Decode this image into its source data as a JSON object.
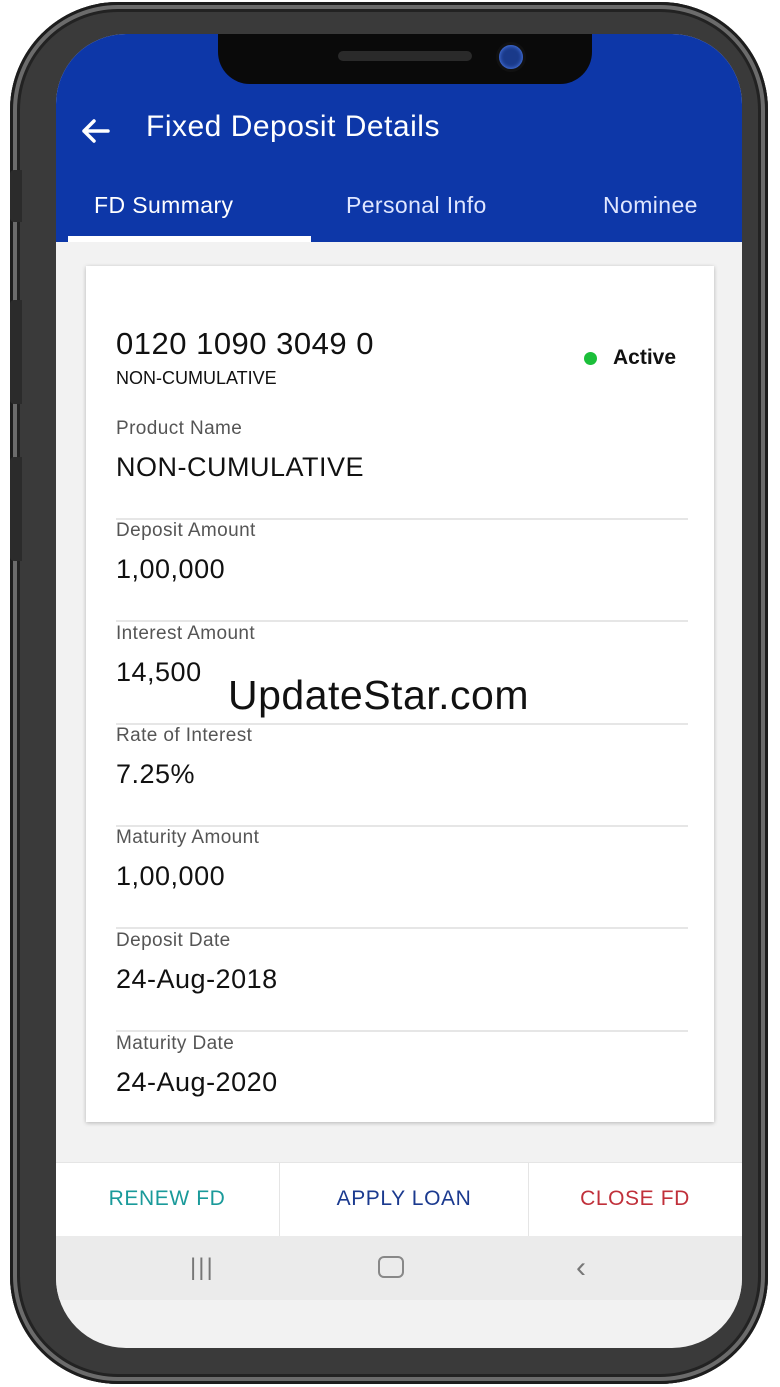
{
  "app": {
    "title": "Fixed Deposit Details",
    "back_icon": "arrow-left-icon"
  },
  "tabs": [
    {
      "label": "FD Summary",
      "active": true
    },
    {
      "label": "Personal Info",
      "active": false
    },
    {
      "label": "Nominee",
      "active": false
    }
  ],
  "account": {
    "number": "0120 1090 3049 0",
    "type": "NON-CUMULATIVE",
    "status": "Active",
    "status_color": "#1bbf3a"
  },
  "fields": [
    {
      "label": "Product Name",
      "value": "NON-CUMULATIVE"
    },
    {
      "label": "Deposit Amount",
      "value": "1,00,000"
    },
    {
      "label": "Interest Amount",
      "value": "14,500"
    },
    {
      "label": "Rate of Interest",
      "value": "7.25%"
    },
    {
      "label": "Maturity Amount",
      "value": "1,00,000"
    },
    {
      "label": "Deposit Date",
      "value": "24-Aug-2018"
    },
    {
      "label": "Maturity Date",
      "value": "24-Aug-2020"
    }
  ],
  "actions": {
    "renew": "RENEW FD",
    "apply_loan": "APPLY LOAN",
    "close": "CLOSE FD"
  },
  "navbar": {
    "recent_icon": "recent-apps-icon",
    "home_icon": "home-icon",
    "back_icon": "nav-back-icon"
  },
  "watermark": "UpdateStar.com",
  "colors": {
    "appbar": "#0d37a8",
    "renew": "#1a9a9a",
    "apply_loan": "#1b3a8f",
    "close": "#c0303a"
  }
}
